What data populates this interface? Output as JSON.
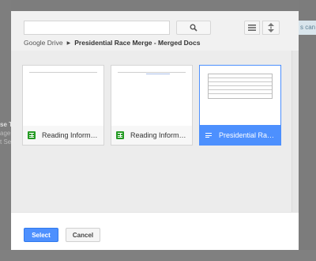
{
  "background": {
    "left_text_strong": "se To",
    "left_text_lines": [
      "age",
      "t Set"
    ],
    "right_note": "s can"
  },
  "search": {
    "value": "",
    "placeholder": ""
  },
  "icons": {
    "search": "search-icon",
    "list_view": "list-view-icon",
    "sort": "sort-icon",
    "sheet": "google-sheets-icon",
    "doc": "google-docs-icon"
  },
  "breadcrumb": {
    "root": "Google Drive",
    "separator": "▶",
    "current": "Presidential Race Merge - Merged Docs"
  },
  "files": [
    {
      "name": "Reading Informatio...",
      "type": "spreadsheet",
      "selected": false
    },
    {
      "name": "Reading Informatio...",
      "type": "spreadsheet",
      "selected": false
    },
    {
      "name": "Presidential Race M...",
      "type": "document",
      "selected": true
    }
  ],
  "footer": {
    "select_label": "Select",
    "cancel_label": "Cancel"
  },
  "colors": {
    "accent": "#4d90fe",
    "sheets_green": "#259b24"
  }
}
